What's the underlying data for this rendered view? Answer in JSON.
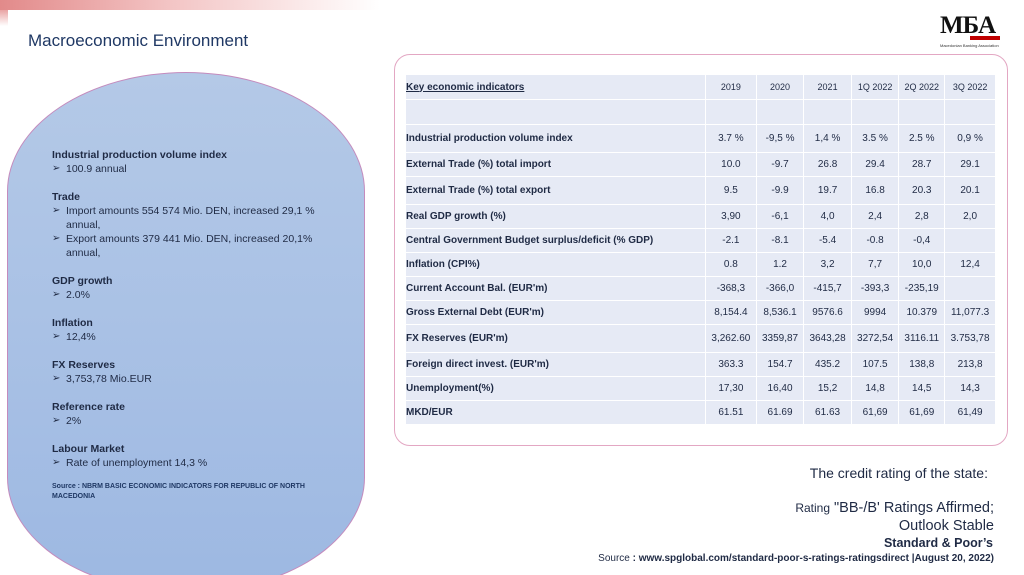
{
  "header": {
    "title": "Macroeconomic Environment",
    "logo_text": "MБA",
    "logo_subtitle": "Macedonian Banking Association"
  },
  "left_panel": {
    "sections": [
      {
        "heading": "Industrial production volume index",
        "bullets": [
          "100.9 annual"
        ]
      },
      {
        "heading": "Trade",
        "bullets": [
          "Import amounts 554 574 Mio. DEN, increased 29,1 % annual,",
          "Export amounts 379 441 Mio. DEN, increased 20,1% annual,"
        ]
      },
      {
        "heading": "GDP growth",
        "bullets": [
          "2.0%"
        ]
      },
      {
        "heading": "Inflation",
        "bullets": [
          "12,4%"
        ]
      },
      {
        "heading": "FX Reserves",
        "bullets": [
          "3,753,78 Mio.EUR"
        ]
      },
      {
        "heading": "Reference rate",
        "bullets": [
          "2%"
        ]
      },
      {
        "heading": "Labour Market",
        "bullets": [
          "Rate of unemployment 14,3 %"
        ]
      }
    ],
    "source": "Source : NBRM BASIC ECONOMIC INDICATORS FOR REPUBLIC OF NORTH MACEDONIA",
    "bullet_icon": "arrow-bullet-icon"
  },
  "table": {
    "title": "Key economic indicators",
    "columns": [
      "2019",
      "2020",
      "2021",
      "1Q 2022",
      "2Q 2022",
      "3Q 2022"
    ],
    "rows": [
      {
        "label": "Industrial production volume index",
        "values": [
          "3.7 %",
          "-9,5 %",
          "1,4 %",
          "3.5 %",
          "2.5 %",
          "0,9 %"
        ]
      },
      {
        "label": "External Trade (%) total import",
        "values": [
          "10.0",
          "-9.7",
          "26.8",
          "29.4",
          "28.7",
          "29.1"
        ]
      },
      {
        "label": "External Trade (%) total export",
        "values": [
          "9.5",
          "-9.9",
          "19.7",
          "16.8",
          "20.3",
          "20.1"
        ]
      },
      {
        "label": "Real GDP growth (%)",
        "values": [
          "3,90",
          "-6,1",
          "4,0",
          "2,4",
          "2,8",
          "2,0"
        ]
      },
      {
        "label": "Central Government Budget surplus/deficit (% GDP)",
        "values": [
          "-2.1",
          "-8.1",
          "-5.4",
          "-0.8",
          "-0,4",
          ""
        ]
      },
      {
        "label": "Inflation (CPI%)",
        "values": [
          "0.8",
          "1.2",
          "3,2",
          "7,7",
          "10,0",
          "12,4"
        ]
      },
      {
        "label": "Current Account Bal.  (EUR'm)",
        "values": [
          "-368,3",
          "-366,0",
          "-415,7",
          "-393,3",
          "-235,19",
          ""
        ]
      },
      {
        "label": "Gross External Debt (EUR'm)",
        "values": [
          "8,154.4",
          "8,536.1",
          "9576.6",
          "9994",
          "10.379",
          "11,077.3"
        ]
      },
      {
        "label": "FX Reserves (EUR'm)",
        "values": [
          "3,262.60",
          "3359,87",
          "3643,28",
          "3272,54",
          "3116.11",
          "3.753,78"
        ]
      },
      {
        "label": "Foreign direct invest. (EUR'm)",
        "values": [
          "363.3",
          "154.7",
          "435.2",
          "107.5",
          "138,8",
          "213,8"
        ]
      },
      {
        "label": "Unemployment(%)",
        "values": [
          "17,30",
          "16,40",
          "15,2",
          "14,8",
          "14,5",
          "14,3"
        ]
      },
      {
        "label": "MKD/EUR",
        "values": [
          "61.51",
          "61.69",
          "61.63",
          "61,69",
          "61,69",
          "61,49"
        ]
      }
    ]
  },
  "credit": {
    "title": "The credit rating of the state:",
    "rating_prefix": "Rating",
    "rating_line1": "\"BB-/B' Ratings Affirmed;",
    "rating_line2": "Outlook Stable",
    "agency": "Standard & Poor’s",
    "source_label": "Source",
    "source_text": ": www.spglobal.com/standard-poor-s-ratings-ratingsdirect |August 20, 2022)"
  }
}
